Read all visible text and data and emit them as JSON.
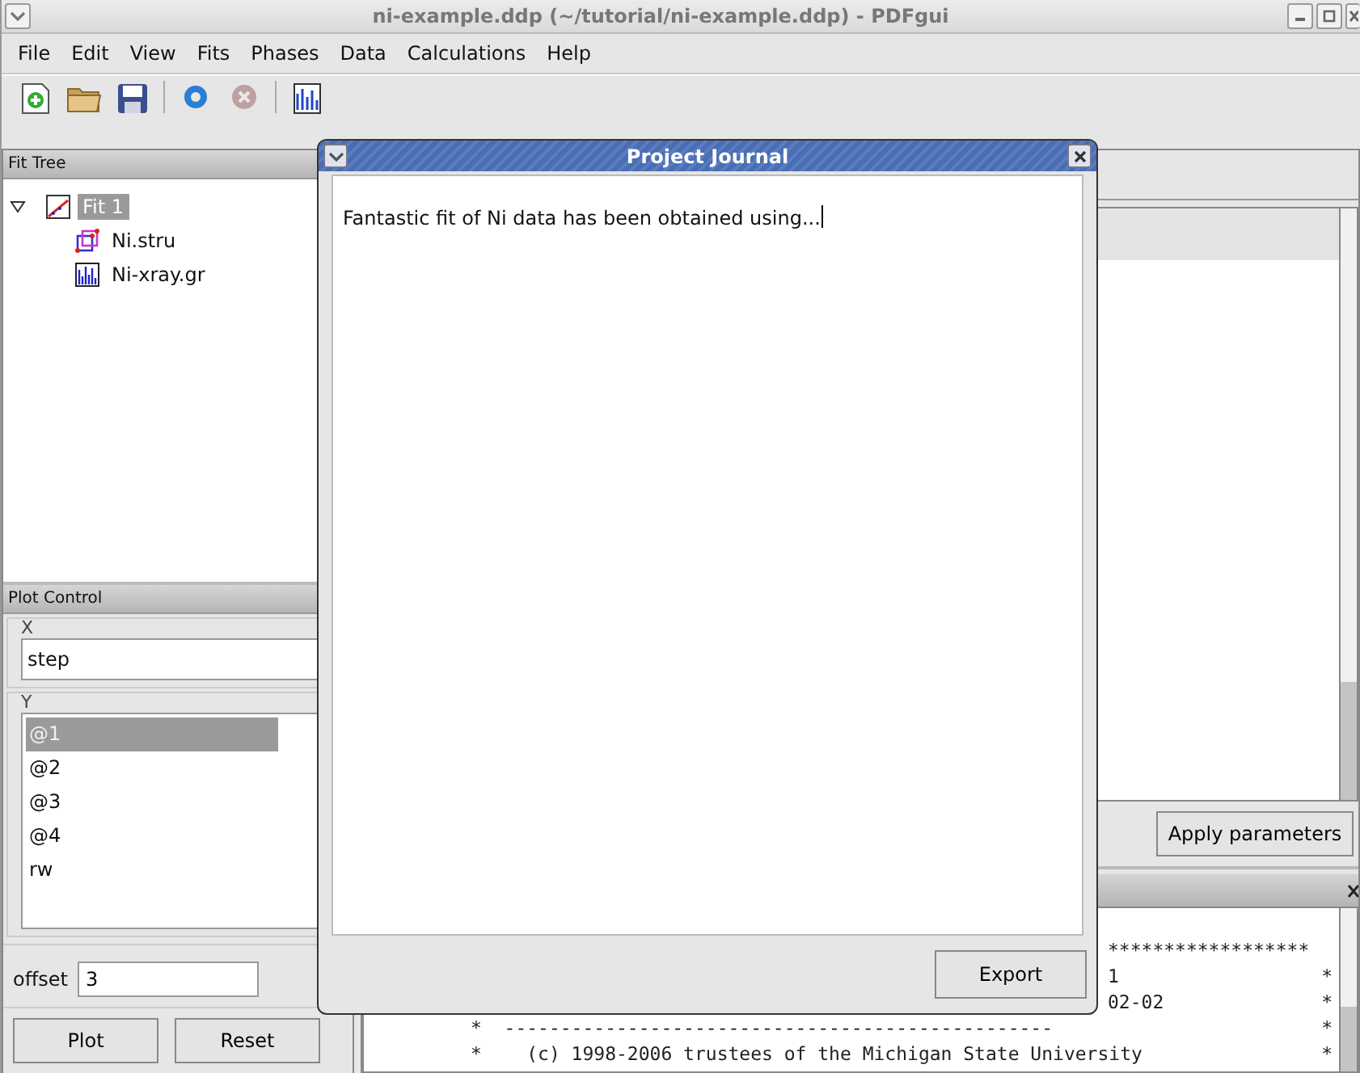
{
  "window": {
    "title": "ni-example.ddp (~/tutorial/ni-example.ddp) - PDFgui"
  },
  "menu": [
    "File",
    "Edit",
    "View",
    "Fits",
    "Phases",
    "Data",
    "Calculations",
    "Help"
  ],
  "toolbar": [
    {
      "kind": "new"
    },
    {
      "kind": "open"
    },
    {
      "kind": "save"
    },
    {
      "kind": "separator"
    },
    {
      "kind": "run"
    },
    {
      "kind": "stop",
      "disabled": true
    },
    {
      "kind": "separator"
    },
    {
      "kind": "plot"
    }
  ],
  "fit_tree": {
    "title": "Fit Tree",
    "items": [
      {
        "label": "Fit 1",
        "kind": "fit",
        "expanded": true,
        "selected": true,
        "children": [
          {
            "label": "Ni.stru",
            "kind": "structure",
            "selected": false
          },
          {
            "label": "Ni-xray.gr",
            "kind": "data",
            "selected": false
          }
        ]
      }
    ]
  },
  "plot_control": {
    "title": "Plot Control",
    "x": {
      "legend": "X",
      "value": "step"
    },
    "y": {
      "legend": "Y",
      "items": [
        {
          "label": "@1",
          "selected": true
        },
        {
          "label": "@2",
          "selected": false
        },
        {
          "label": "@3",
          "selected": false
        },
        {
          "label": "@4",
          "selected": false
        },
        {
          "label": "rw",
          "selected": false
        }
      ]
    },
    "offset": {
      "label": "offset",
      "value": "3"
    },
    "buttons": [
      "Plot",
      "Reset"
    ]
  },
  "parameters": {
    "button": "Apply parameters"
  },
  "console": {
    "lines": [
      {
        "text": "******************",
        "kind": "indented"
      },
      {
        "text": "1",
        "end": "*",
        "kind": "indented"
      },
      {
        "text": "02-02",
        "end": "*",
        "kind": "indented"
      },
      {
        "text": "*  -------------------------------------------------",
        "end": "*",
        "kind": "plain"
      },
      {
        "text": "*    (c) 1998-2006 trustees of the Michigan State University",
        "end": "*",
        "kind": "plain"
      }
    ]
  },
  "journal": {
    "title": "Project Journal",
    "text": "Fantastic fit of Ni data has been obtained using...",
    "button": "Export"
  }
}
